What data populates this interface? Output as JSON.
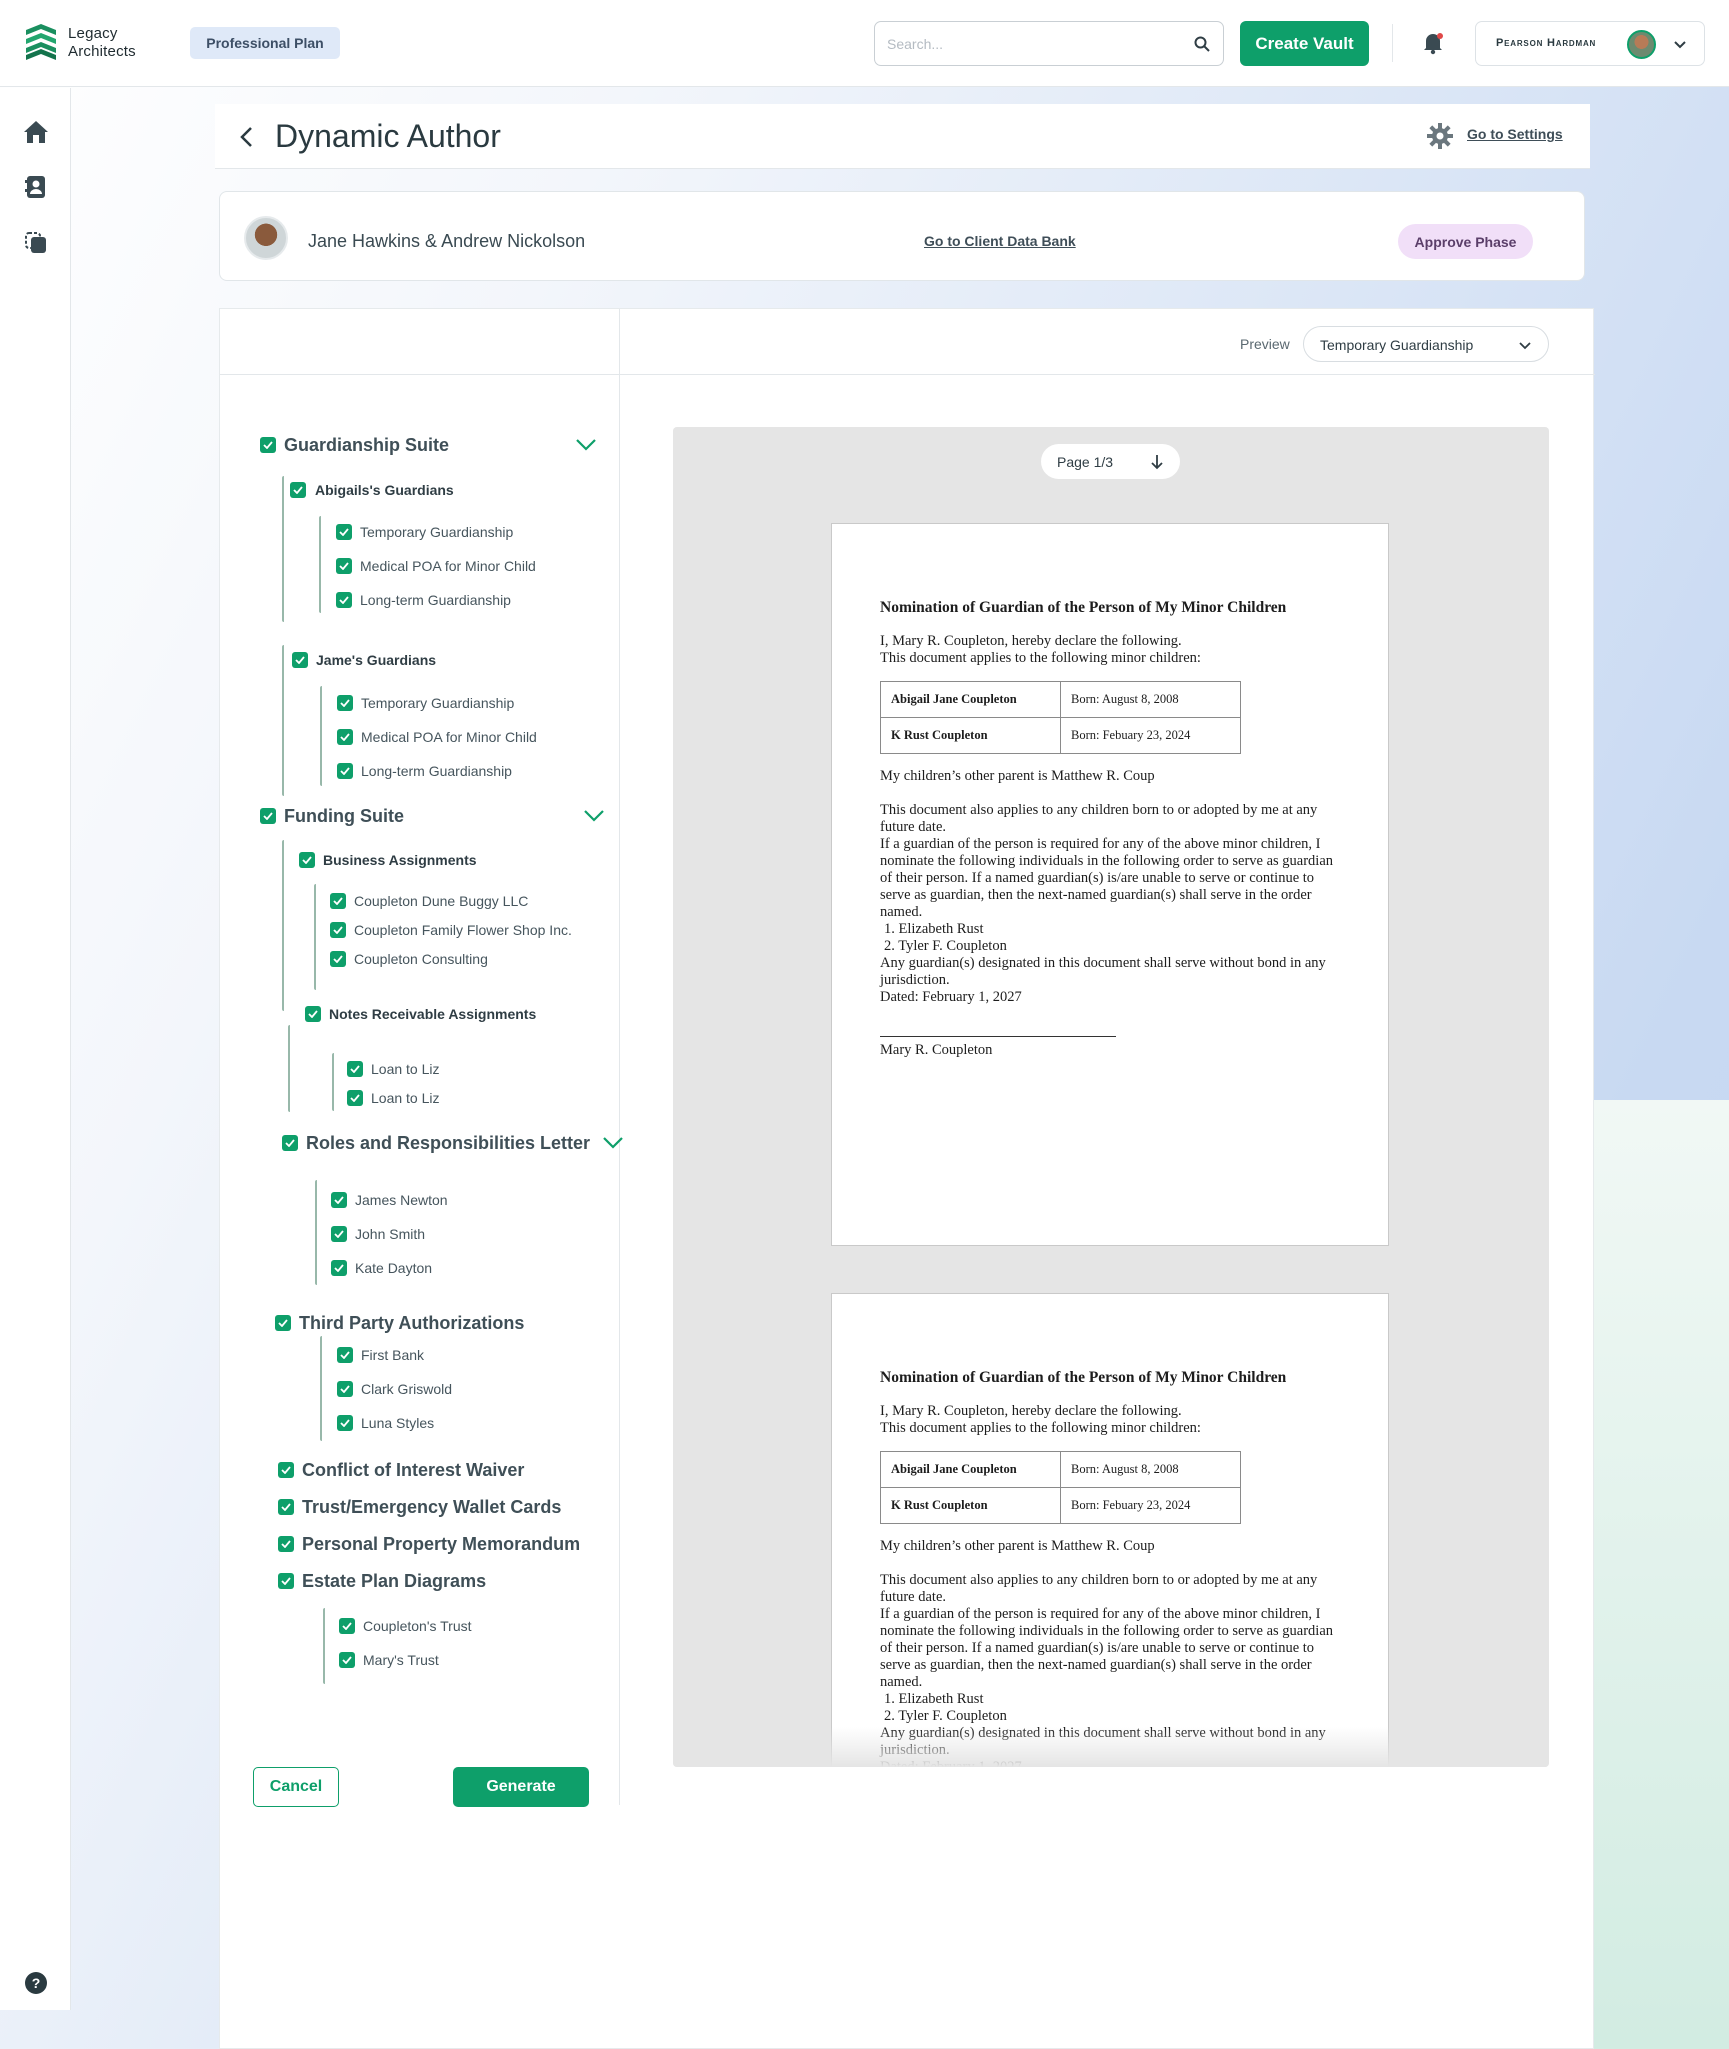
{
  "app": {
    "brand_line1": "Legacy",
    "brand_line2": "Architects",
    "plan": "Professional Plan",
    "search_placeholder": "Search...",
    "create_vault": "Create Vault",
    "user_name": "Pearson Hardman"
  },
  "header": {
    "title": "Dynamic Author",
    "settings_link": "Go to Settings"
  },
  "client": {
    "name": "Jane Hawkins & Andrew Nickolson",
    "databank_link": "Go to Client Data Bank",
    "approve": "Approve Phase"
  },
  "preview": {
    "label": "Preview",
    "selected": "Temporary Guardianship",
    "page_indicator": "Page 1/3"
  },
  "tree": {
    "guardianship": {
      "label": "Guardianship Suite",
      "abigail": "Abigails's Guardians",
      "abigail_items": [
        "Temporary Guardianship",
        "Medical POA for Minor Child",
        "Long-term Guardianship"
      ],
      "jame": "Jame's Guardians",
      "jame_items": [
        "Temporary Guardianship",
        "Medical POA for Minor Child",
        "Long-term Guardianship"
      ]
    },
    "funding": {
      "label": "Funding Suite",
      "business": "Business Assignments",
      "business_items": [
        "Coupleton Dune Buggy LLC",
        "Coupleton Family Flower Shop Inc.",
        "Coupleton Consulting"
      ],
      "notes": "Notes Receivable Assignments",
      "notes_items": [
        "Loan to Liz",
        "Loan to Liz"
      ]
    },
    "roles": {
      "label": "Roles and Responsibilities Letter",
      "items": [
        "James Newton",
        "John Smith",
        "Kate Dayton"
      ]
    },
    "third_party": {
      "label": "Third Party Authorizations",
      "items": [
        "First Bank",
        "Clark Griswold",
        "Luna Styles"
      ]
    },
    "conflict": "Conflict of Interest Waiver",
    "wallet": "Trust/Emergency Wallet Cards",
    "property": "Personal Property Memorandum",
    "diagrams": {
      "label": "Estate Plan Diagrams",
      "items": [
        "Coupleton's Trust",
        "Mary's Trust"
      ]
    }
  },
  "actions": {
    "cancel": "Cancel",
    "generate": "Generate"
  },
  "document": {
    "title": "Nomination of Guardian of the Person of My Minor Children",
    "intro1": "I, Mary R. Coupleton, hereby declare the following.",
    "intro2": "This document applies to the following minor children:",
    "children": [
      {
        "name": "Abigail Jane Coupleton",
        "born": "Born: August 8, 2008"
      },
      {
        "name": "K Rust Coupleton",
        "born": "Born: Febuary 23, 2024"
      }
    ],
    "other_parent": "My children’s other parent is Matthew R. Coup",
    "para1": "This document also applies to any children born to or adopted by me at any future date.",
    "para2": "If a guardian of the person is required for any of the above minor children, I nominate the following individuals in the following order to serve as guardian of their person. If a named guardian(s) is/are unable to serve or continue to serve as guardian, then the next-named guardian(s) shall serve in the order named.",
    "guardian1": "1. Elizabeth Rust",
    "guardian2": "2. Tyler F. Coupleton",
    "bond": "Any guardian(s) designated in this document shall serve without bond in any jurisdiction.",
    "dated": "Dated: February 1, 2027",
    "signer": "Mary R. Coupleton"
  }
}
